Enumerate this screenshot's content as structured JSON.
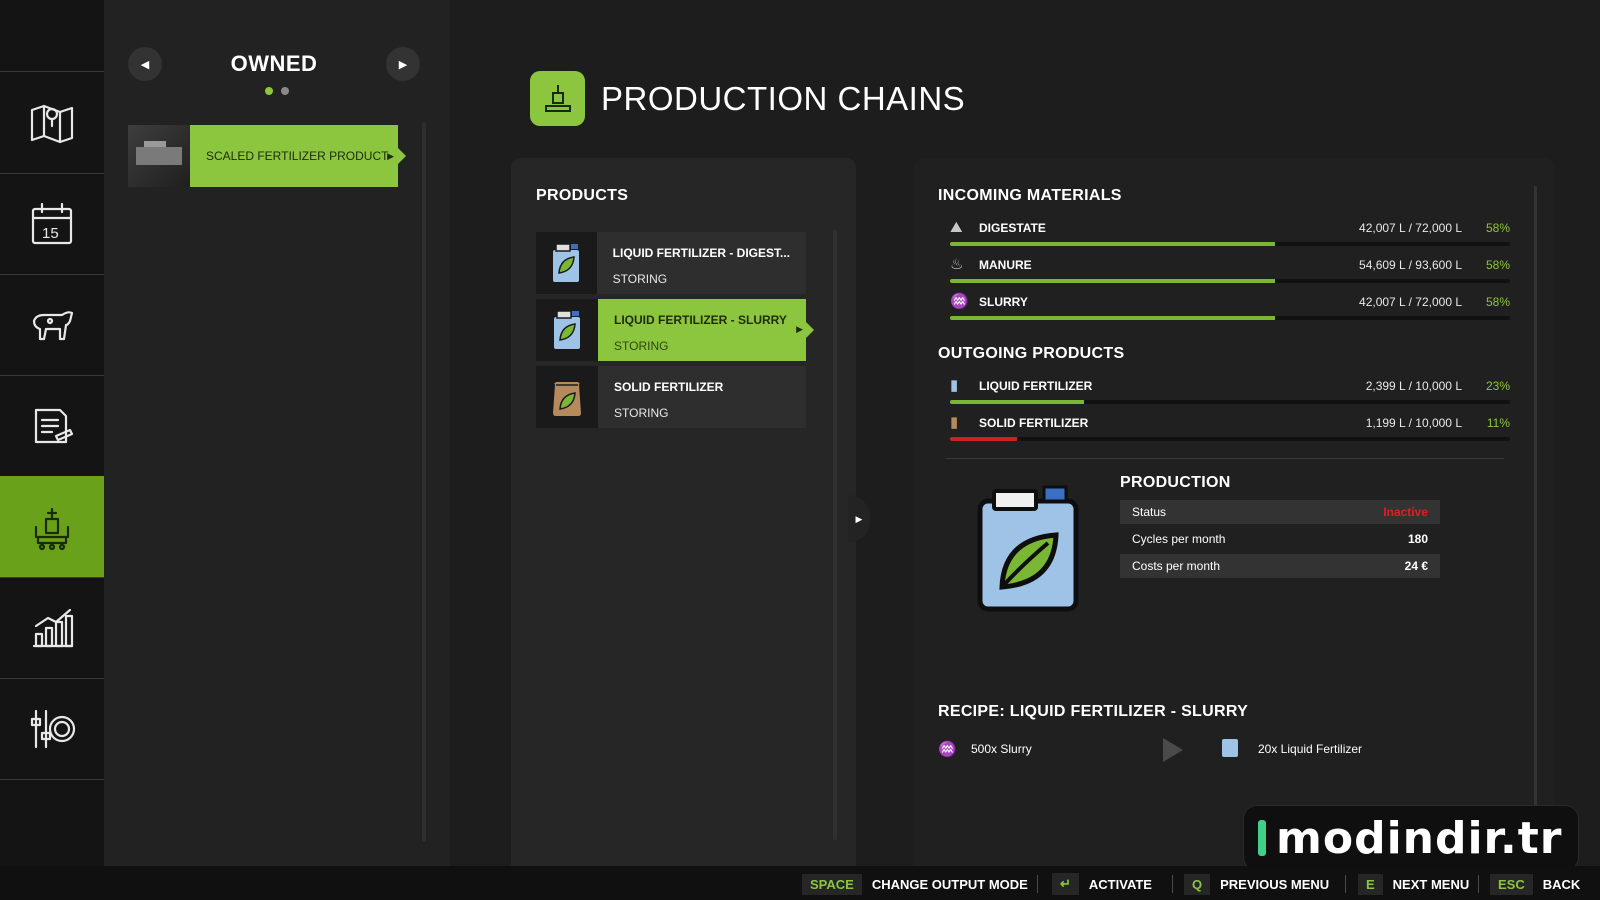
{
  "owned": {
    "title": "OWNED",
    "prev_icon": "triangle-left-icon",
    "next_icon": "triangle-right-icon",
    "page_count": 2,
    "current_page": 1,
    "items": [
      {
        "label": "SCALED FERTILIZER PRODUCT",
        "selected": true
      }
    ]
  },
  "rail": {
    "items": [
      {
        "icon": "map-icon",
        "active": false
      },
      {
        "icon": "calendar-icon",
        "active": false
      },
      {
        "icon": "animals-icon",
        "active": false
      },
      {
        "icon": "contracts-icon",
        "active": false
      },
      {
        "icon": "production-icon",
        "active": true
      },
      {
        "icon": "statistics-icon",
        "active": false
      },
      {
        "icon": "settings-icon",
        "active": false
      }
    ]
  },
  "header": {
    "title": "PRODUCTION CHAINS",
    "icon": "production-icon"
  },
  "products": {
    "title": "PRODUCTS",
    "items": [
      {
        "name": "LIQUID FERTILIZER - DIGEST...",
        "status": "STORING",
        "icon": "liquid-fertilizer-icon",
        "selected": false
      },
      {
        "name": "LIQUID FERTILIZER - SLURRY",
        "status": "STORING",
        "icon": "liquid-fertilizer-icon",
        "selected": true
      },
      {
        "name": "SOLID FERTILIZER",
        "status": "STORING",
        "icon": "solid-fertilizer-icon",
        "selected": false
      }
    ]
  },
  "incoming": {
    "title": "INCOMING MATERIALS",
    "items": [
      {
        "name": "DIGESTATE",
        "amount": "42,007 L / 72,000 L",
        "percent": "58%",
        "fill": 0.58,
        "icon": "digestate-icon"
      },
      {
        "name": "MANURE",
        "amount": "54,609 L / 93,600 L",
        "percent": "58%",
        "fill": 0.58,
        "icon": "manure-icon"
      },
      {
        "name": "SLURRY",
        "amount": "42,007 L / 72,000 L",
        "percent": "58%",
        "fill": 0.58,
        "icon": "slurry-icon"
      }
    ]
  },
  "outgoing": {
    "title": "OUTGOING PRODUCTS",
    "items": [
      {
        "name": "LIQUID FERTILIZER",
        "amount": "2,399 L / 10,000 L",
        "percent": "23%",
        "fill": 0.24,
        "icon": "liquid-fertilizer-icon"
      },
      {
        "name": "SOLID FERTILIZER",
        "amount": "1,199 L / 10,000 L",
        "percent": "11%",
        "fill": 0.12,
        "icon": "solid-fertilizer-icon"
      }
    ]
  },
  "production": {
    "title": "PRODUCTION",
    "rows": [
      {
        "label": "Status",
        "value": "Inactive"
      },
      {
        "label": "Cycles per month",
        "value": "180"
      },
      {
        "label": "Costs per month",
        "value": "24 €"
      }
    ]
  },
  "recipe": {
    "title": "RECIPE: LIQUID FERTILIZER - SLURRY",
    "input": "500x Slurry",
    "output": "20x Liquid Fertilizer"
  },
  "watermark": "modindir.tr",
  "footer": {
    "hints": [
      {
        "key": "SPACE",
        "label": "CHANGE OUTPUT MODE"
      },
      {
        "key": "↵",
        "label": "ACTIVATE"
      },
      {
        "key": "Q",
        "label": "PREVIOUS MENU"
      },
      {
        "key": "E",
        "label": "NEXT MENU"
      },
      {
        "key": "ESC",
        "label": "BACK"
      }
    ]
  },
  "colors": {
    "accent": "#8cc63f",
    "bar_fill": "#7ab734",
    "bar_low": "#d02020",
    "status_inactive": "#e02020"
  }
}
